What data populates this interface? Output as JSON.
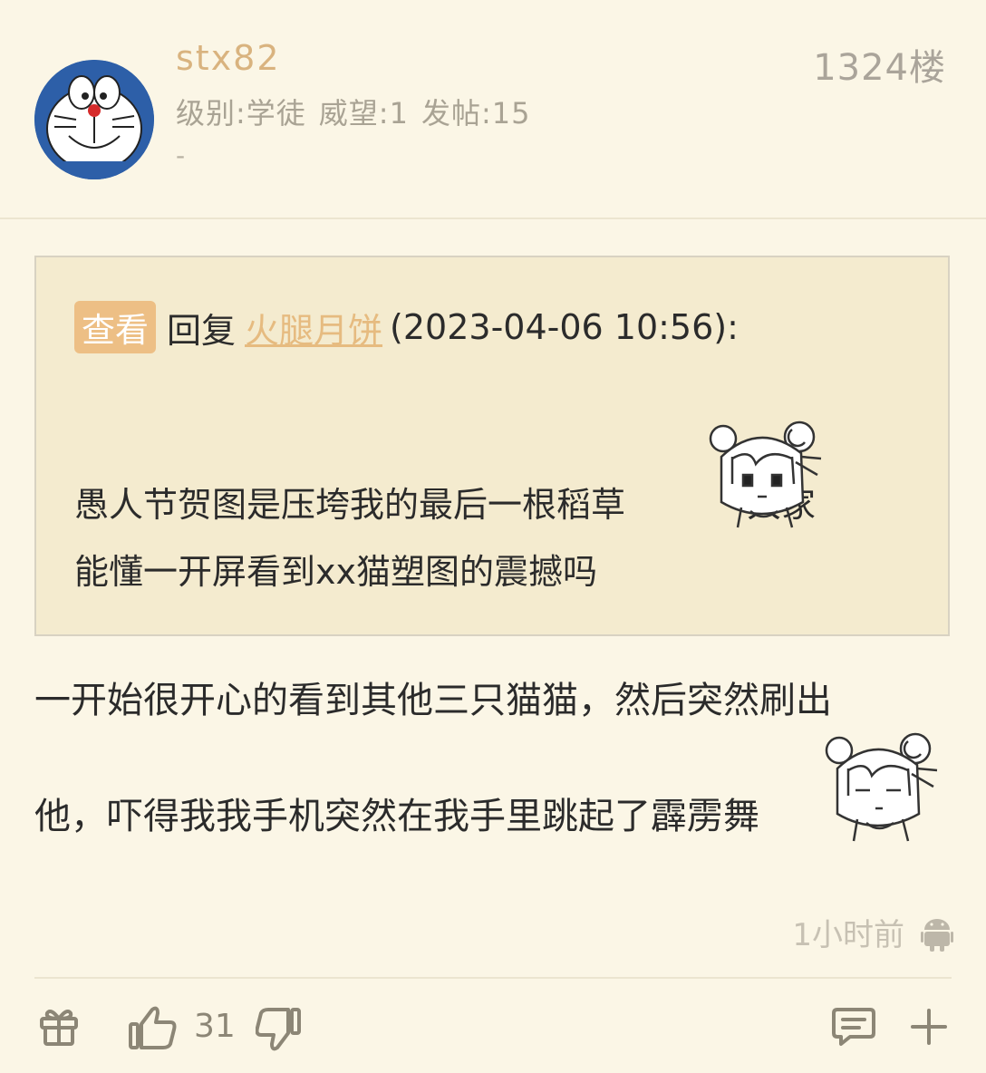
{
  "post": {
    "username": "stx82",
    "floor": "1324楼",
    "level": "级别:学徒",
    "prestige": "威望:1",
    "posts": "发帖:15",
    "signature": "-"
  },
  "quote": {
    "view_label": "查看",
    "reply_word": "回复",
    "quoted_user": "火腿月饼",
    "quoted_time": "(2023-04-06 10:56):",
    "text_line1": "愚人节贺图是压垮我的最后一根稻草",
    "text_line1_tail": "大家",
    "text_line2": "能懂一开屏看到xx猫塑图的震撼吗"
  },
  "body": {
    "line1": "一开始很开心的看到其他三只猫猫，然后突然刷出",
    "line2": "他，吓得我我手机突然在我手里跳起了霹雳舞"
  },
  "timestamp": "1小时前",
  "actions": {
    "like_count": "31"
  },
  "colors": {
    "background": "#fbf6e6",
    "quote_bg": "#f4ebcf",
    "accent": "#e6bb80",
    "view_button": "#edbf85"
  }
}
